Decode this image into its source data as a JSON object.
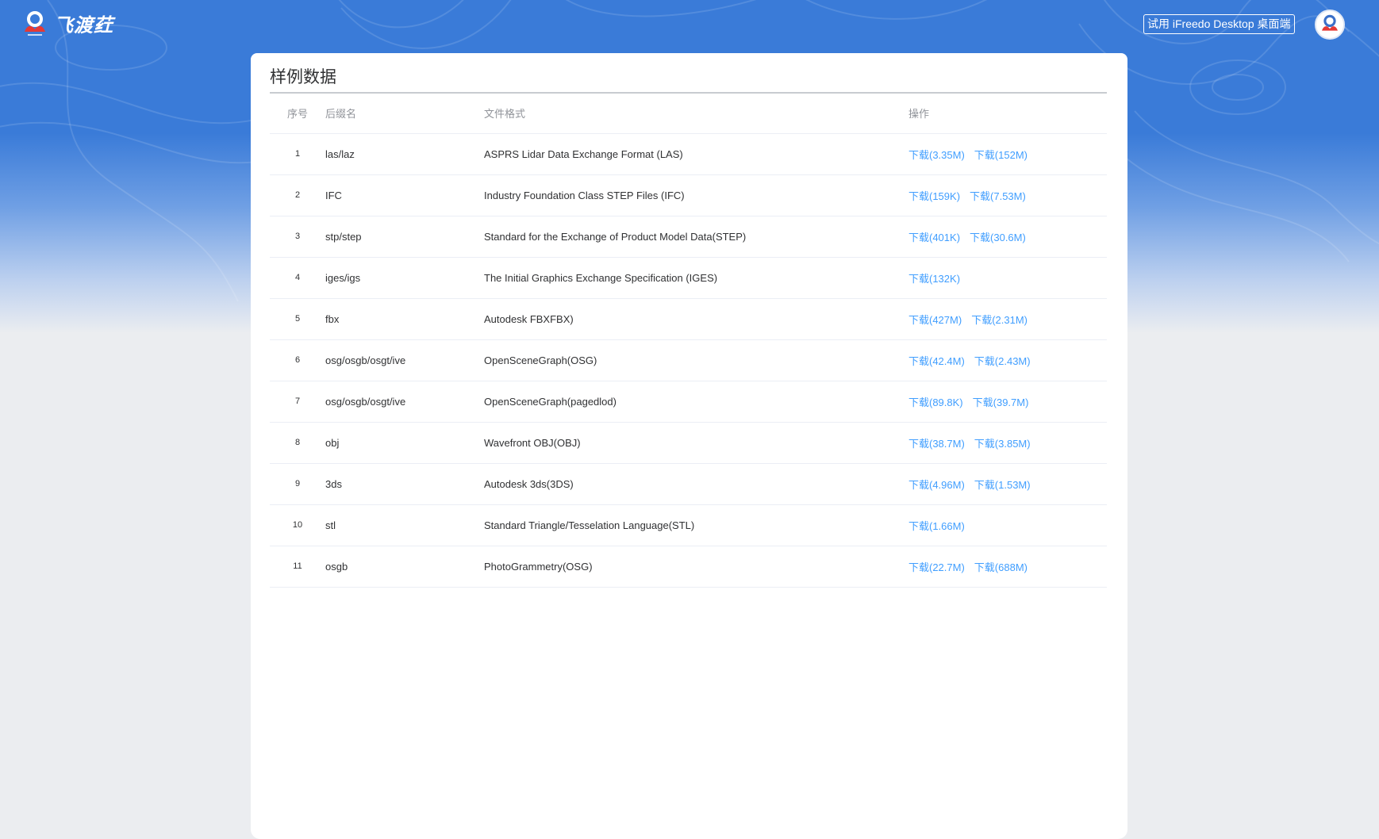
{
  "brand": {
    "name": "飞渡荭",
    "logo_icon": "ifreedo-logo-icon"
  },
  "header": {
    "try_desktop_label": "试用 iFreedo Desktop 桌面端",
    "avatar_icon": "user-avatar-icon"
  },
  "page": {
    "title": "样例数据"
  },
  "table": {
    "headers": {
      "index": "序号",
      "extension": "后缀名",
      "format": "文件格式",
      "actions": "操作"
    },
    "rows": [
      {
        "index": "1",
        "extension": "las/laz",
        "format": "ASPRS Lidar Data Exchange Format (LAS)",
        "downloads": [
          "下载(3.35M)",
          "下载(152M)"
        ]
      },
      {
        "index": "2",
        "extension": "IFC",
        "format": "Industry Foundation Class STEP Files (IFC)",
        "downloads": [
          "下载(159K)",
          "下载(7.53M)"
        ]
      },
      {
        "index": "3",
        "extension": "stp/step",
        "format": "Standard for the Exchange of Product Model Data(STEP)",
        "downloads": [
          "下载(401K)",
          "下载(30.6M)"
        ]
      },
      {
        "index": "4",
        "extension": "iges/igs",
        "format": "The Initial Graphics Exchange Specification (IGES)",
        "downloads": [
          "下载(132K)"
        ]
      },
      {
        "index": "5",
        "extension": "fbx",
        "format": "Autodesk FBXFBX)",
        "downloads": [
          "下载(427M)",
          "下载(2.31M)"
        ]
      },
      {
        "index": "6",
        "extension": "osg/osgb/osgt/ive",
        "format": "OpenSceneGraph(OSG)",
        "downloads": [
          "下载(42.4M)",
          "下载(2.43M)"
        ]
      },
      {
        "index": "7",
        "extension": "osg/osgb/osgt/ive",
        "format": "OpenSceneGraph(pagedlod)",
        "downloads": [
          "下载(89.8K)",
          "下载(39.7M)"
        ]
      },
      {
        "index": "8",
        "extension": "obj",
        "format": "Wavefront OBJ(OBJ)",
        "downloads": [
          "下载(38.7M)",
          "下载(3.85M)"
        ]
      },
      {
        "index": "9",
        "extension": "3ds",
        "format": "Autodesk 3ds(3DS)",
        "downloads": [
          "下载(4.96M)",
          "下载(1.53M)"
        ]
      },
      {
        "index": "10",
        "extension": "stl",
        "format": "Standard Triangle/Tesselation Language(STL)",
        "downloads": [
          "下载(1.66M)"
        ]
      },
      {
        "index": "11",
        "extension": "osgb",
        "format": "PhotoGrammetry(OSG)",
        "downloads": [
          "下载(22.7M)",
          "下载(688M)"
        ]
      }
    ]
  },
  "colors": {
    "header_blue": "#3a7bd8",
    "link_blue": "#409eff",
    "page_bg": "#ebedf0"
  }
}
